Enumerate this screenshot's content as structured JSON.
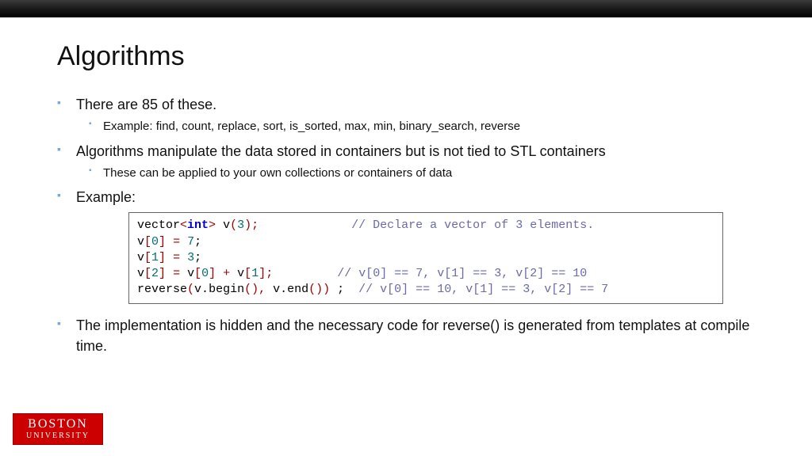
{
  "title": "Algorithms",
  "bullets": {
    "b1": "There are 85 of these.",
    "b1a": "Example: find, count, replace, sort, is_sorted, max, min, binary_search, reverse",
    "b2": "Algorithms manipulate the data stored in containers but is not tied to STL containers",
    "b2a": "These can be applied to your own collections or containers of data",
    "b3": "Example:",
    "b4": "The implementation is hidden and the necessary code for reverse() is generated from templates at compile time."
  },
  "code": {
    "l1_a": "vector",
    "l1_b": "<",
    "l1_c": "int",
    "l1_d": ">",
    "l1_e": " v",
    "l1_f": "(",
    "l1_g": "3",
    "l1_h": ");",
    "l1_pad": "             ",
    "l1_comment": "// Declare a vector of 3 elements.",
    "l2_a": "v",
    "l2_b": "[",
    "l2_c": "0",
    "l2_d": "]",
    "l2_e": " = ",
    "l2_f": "7",
    "l2_g": ";",
    "l3_a": "v",
    "l3_b": "[",
    "l3_c": "1",
    "l3_d": "]",
    "l3_e": " = ",
    "l3_f": "3",
    "l3_g": ";",
    "l4_a": "v",
    "l4_b": "[",
    "l4_c": "2",
    "l4_d": "]",
    "l4_e": " = ",
    "l4_f": "v",
    "l4_g": "[",
    "l4_h": "0",
    "l4_i": "]",
    "l4_j": " + ",
    "l4_k": "v",
    "l4_l": "[",
    "l4_m": "1",
    "l4_n": "];",
    "l4_pad": "         ",
    "l4_comment": "// v[0] == 7, v[1] == 3, v[2] == 10",
    "l5_a": "reverse",
    "l5_b": "(",
    "l5_c": "v",
    "l5_d": ".",
    "l5_e": "begin",
    "l5_f": "(),",
    "l5_g": " v",
    "l5_h": ".",
    "l5_i": "end",
    "l5_j": "())",
    "l5_k": " ;  ",
    "l5_comment": "// v[0] == 10, v[1] == 3, v[2] == 7"
  },
  "logo": {
    "line1": "BOSTON",
    "line2": "UNIVERSITY"
  }
}
